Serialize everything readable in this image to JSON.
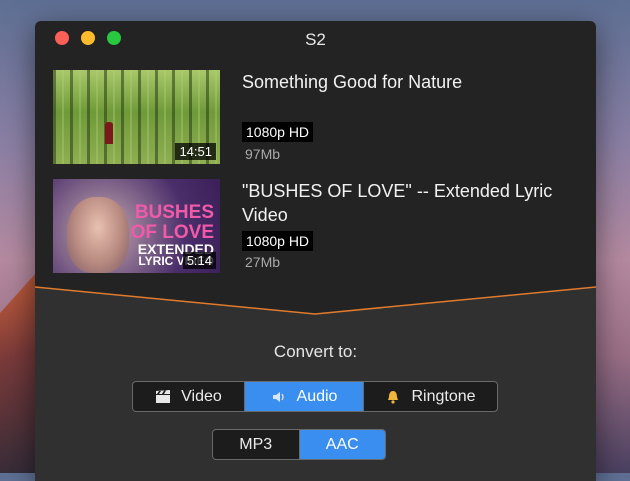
{
  "window": {
    "title": "S2"
  },
  "videos": [
    {
      "title": "Something Good for Nature",
      "duration": "14:51",
      "quality": "1080p HD",
      "size": "97Mb"
    },
    {
      "title": "\"BUSHES OF LOVE\" -- Extended Lyric Video",
      "duration": "5:14",
      "quality": "1080p HD",
      "size": "27Mb",
      "thumb_text": [
        "BUSHES",
        "OF LOVE",
        "EXTENDED",
        "LYRIC VIDEO"
      ]
    }
  ],
  "convert": {
    "label": "Convert to:",
    "types": [
      {
        "label": "Video",
        "icon": "clapperboard-icon",
        "active": false
      },
      {
        "label": "Audio",
        "icon": "speaker-icon",
        "active": true
      },
      {
        "label": "Ringtone",
        "icon": "bell-icon",
        "active": false
      }
    ],
    "formats": [
      {
        "label": "MP3",
        "active": false
      },
      {
        "label": "AAC",
        "active": true
      }
    ]
  },
  "colors": {
    "accent": "#3a8ef0",
    "divider": "#e07a2e",
    "window_bg": "#232323",
    "panel_bg": "#303030"
  }
}
